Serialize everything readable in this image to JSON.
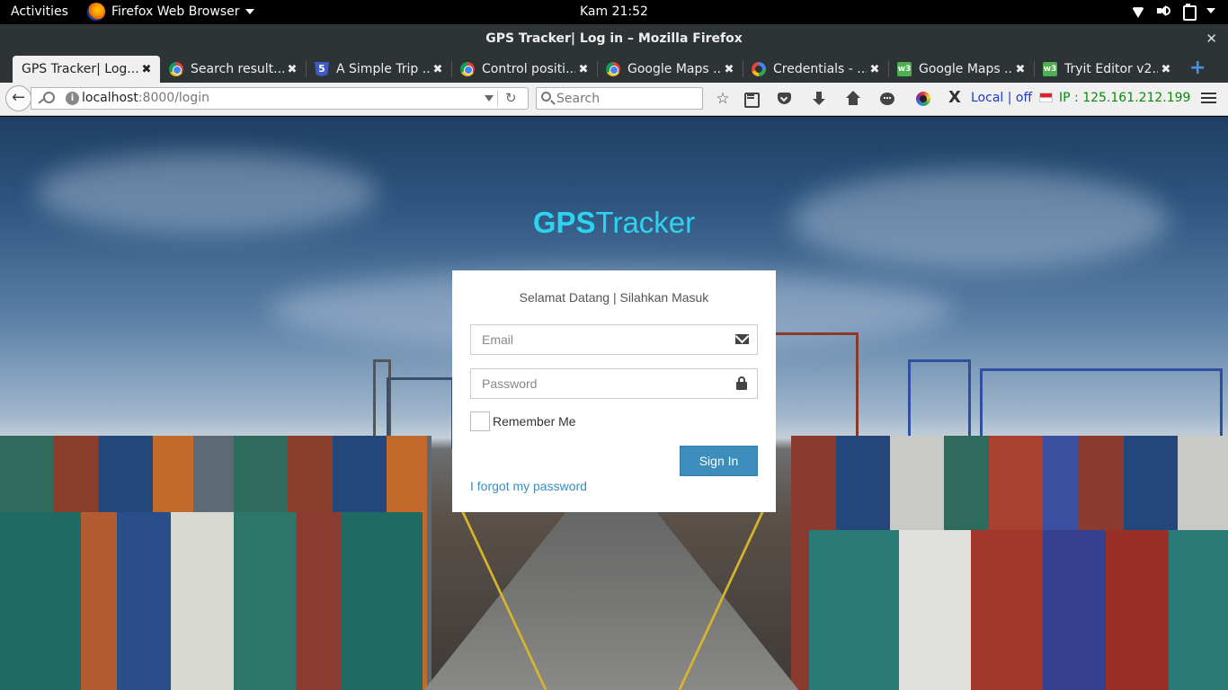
{
  "topbar": {
    "activities": "Activities",
    "app_name": "Firefox Web Browser",
    "clock": "Kam 21:52"
  },
  "window": {
    "title": "GPS Tracker| Log in – Mozilla Firefox",
    "close": "✕"
  },
  "tabs": [
    {
      "title": "GPS Tracker| Log...",
      "icon": "none",
      "active": true
    },
    {
      "title": "Search result...",
      "icon": "chrome-icon"
    },
    {
      "title": "A Simple Trip ...",
      "icon": "html5-icon"
    },
    {
      "title": "Control positi...",
      "icon": "chrome-icon"
    },
    {
      "title": "Google Maps ...",
      "icon": "chrome-icon"
    },
    {
      "title": "Credentials - ...",
      "icon": "google-icon"
    },
    {
      "title": "Google Maps ...",
      "icon": "w3schools-icon"
    },
    {
      "title": "Tryit Editor v2...",
      "icon": "w3schools-icon"
    }
  ],
  "tab_close": "✖",
  "newtab": "+",
  "navbar": {
    "back": "←",
    "url_host": "localhost",
    "url_path": ":8000/login",
    "reload": "↻",
    "search_placeholder": "Search",
    "star": "☆",
    "x_ext": "X",
    "ip_local": "Local | off",
    "ip_label": "IP : 125.161.212.199"
  },
  "page": {
    "brand_bold": "GPS",
    "brand_light": "Tracker",
    "login": {
      "message": "Selamat Datang | Silahkan Masuk",
      "email_placeholder": "Email",
      "password_placeholder": "Password",
      "remember": "Remember Me",
      "signin": "Sign In",
      "forgot": "I forgot my password"
    }
  },
  "colors": {
    "brand": "#2ed3f0",
    "button": "#3c8dbc",
    "link": "#3c8dbc"
  }
}
